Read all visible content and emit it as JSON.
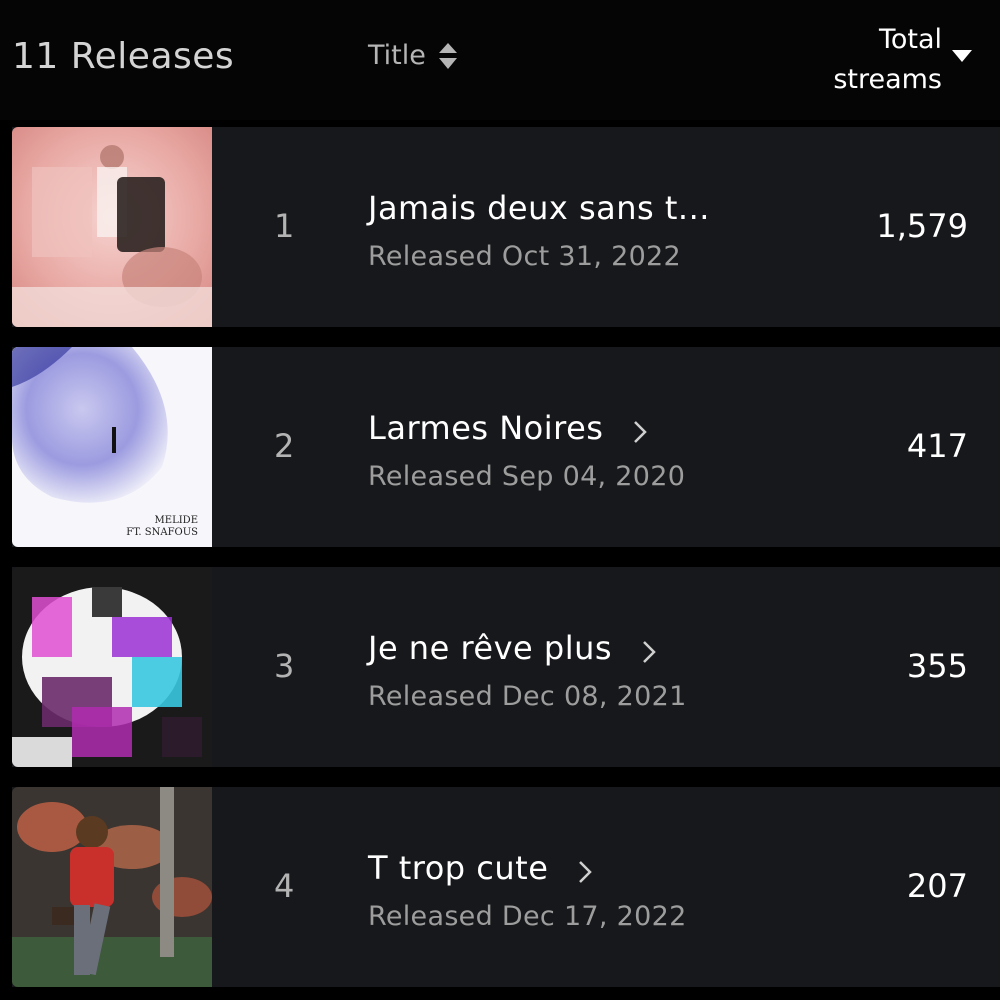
{
  "header": {
    "count_label": "11 Releases",
    "title_label": "Title",
    "streams_label_line1": "Total",
    "streams_label_line2": "streams"
  },
  "releases": [
    {
      "rank": "1",
      "title": "Jamais deux sans t...",
      "released": "Released Oct 31, 2022",
      "streams": "1,579",
      "has_chevron": false
    },
    {
      "rank": "2",
      "title": "Larmes Noires",
      "released": "Released Sep 04, 2020",
      "streams": "417",
      "has_chevron": true,
      "art_text_1": "MELIDE",
      "art_text_2": "FT. SNAFOUS"
    },
    {
      "rank": "3",
      "title": "Je ne rêve plus",
      "released": "Released Dec 08, 2021",
      "streams": "355",
      "has_chevron": true
    },
    {
      "rank": "4",
      "title": "T trop cute",
      "released": "Released Dec 17, 2022",
      "streams": "207",
      "has_chevron": true
    }
  ],
  "icons": {
    "sort": "sort-up-down-icon",
    "caret": "caret-down-icon",
    "chevron": "chevron-right-icon"
  },
  "colors": {
    "background": "#000000",
    "row_background": "#17181b",
    "primary_text": "#ffffff",
    "secondary_text": "#9d9d9d"
  }
}
